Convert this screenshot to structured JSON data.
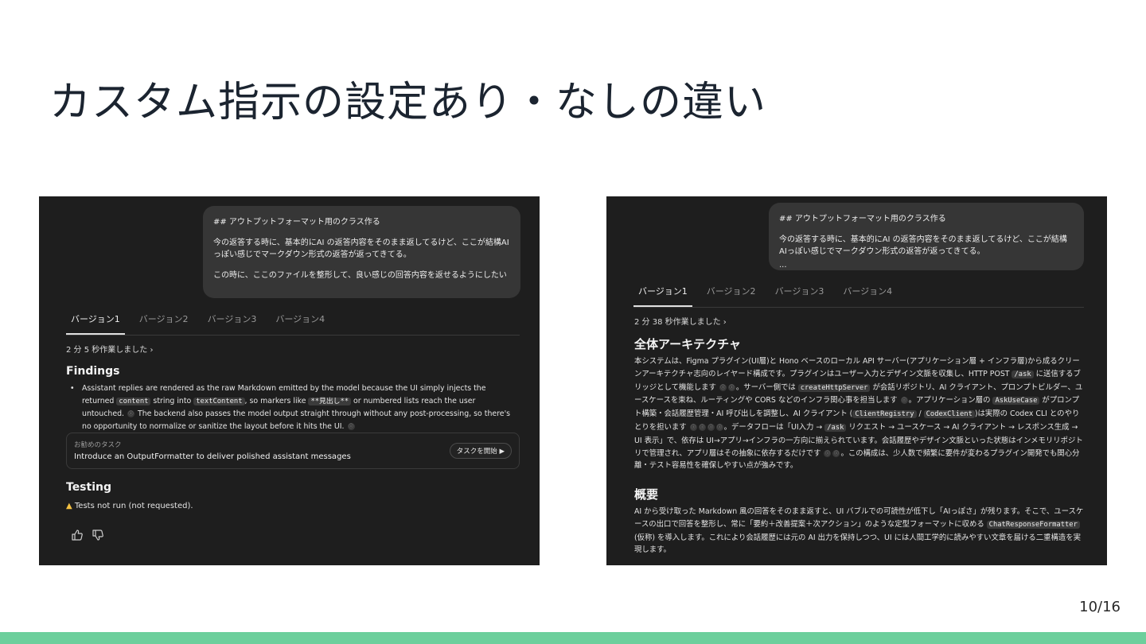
{
  "slide": {
    "title": "カスタム指示の設定あり・なしの違い",
    "page_number": "10/16",
    "accent_color": "#6ccf9c"
  },
  "left": {
    "bubble": {
      "heading": "## アウトプットフォーマット用のクラス作る",
      "para1": "今の返答する時に、基本的にAI の返答内容をそのまま返してるけど、ここが結構AIっぽい感じでマークダウン形式の返答が返ってきてる。",
      "para2": "この時に、ここのファイルを整形して、良い感じの回答内容を返せるようにしたい"
    },
    "tabs": [
      "バージョン1",
      "バージョン2",
      "バージョン3",
      "バージョン4"
    ],
    "worked": "2 分 5 秒作業しました ›",
    "findings_title": "Findings",
    "findings_bullet": {
      "t1": "Assistant replies are rendered as the raw Markdown emitted by the model because the UI simply injects the returned ",
      "c1": "content",
      "t2": " string into ",
      "c2": "textContent",
      "t3": ", so markers like ",
      "c3": "**見出し**",
      "t4": " or numbered lists reach the user untouched. ",
      "t5": " The backend also passes the model output straight through without any post-processing, so there's no opportunity to normalize or sanitize the layout before it hits the UI. "
    },
    "task": {
      "label": "お勧めのタスク",
      "title": "Introduce an OutputFormatter to deliver polished assistant messages",
      "button": "タスクを開始 ▶"
    },
    "testing_title": "Testing",
    "testing_text": "Tests not run (not requested).",
    "icons": [
      "thumbs-up-icon",
      "thumbs-down-icon"
    ]
  },
  "right": {
    "bubble": {
      "heading": "## アウトプットフォーマット用のクラス作る",
      "para1": "今の返答する時に、基本的にAI の返答内容をそのまま返してるけど、ここが結構AIっぽい感じでマークダウン形式の返答が返ってきてる。",
      "para2": "..."
    },
    "tabs": [
      "バージョン1",
      "バージョン2",
      "バージョン3",
      "バージョン4"
    ],
    "worked": "2 分 38 秒作業しました ›",
    "arch_title": "全体アーキテクチャ",
    "arch": {
      "t1": "本システムは、Figma プラグイン(UI層)と Hono ベースのローカル API サーバー(アプリケーション層 + インフラ層)から成るクリーンアーキテクチャ志向のレイヤード構成です。プラグインはユーザー入力とデザイン文脈を収集し、HTTP POST ",
      "c1": "/ask",
      "t2": " に送信するブリッジとして機能します ",
      "t3": "。サーバー側では ",
      "c2": "createHttpServer",
      "t4": " が会話リポジトリ、AI クライアント、プロンプトビルダー、ユースケースを束ね、ルーティングや CORS などのインフラ関心事を担当します ",
      "t5": "。アプリケーション層の ",
      "c3": "AskUseCase",
      "t6": " がプロンプト構築・会話履歴管理・AI 呼び出しを調整し、AI クライアント (",
      "c4": "ClientRegistry",
      "t7": " / ",
      "c5": "CodexClient",
      "t8": ")は実際の Codex CLI とのやりとりを担います ",
      "t9": "。データフローは「UI入力 → ",
      "c6": "/ask",
      "t10": " リクエスト → ユースケース → AI クライアント → レスポンス生成 → UI 表示」で、依存は UI→アプリ→インフラの一方向に揃えられています。会話履歴やデザイン文脈といった状態はインメモリリポジトリで管理され、アプリ層はその抽象に依存するだけです ",
      "t11": "。この構成は、少人数で頻繁に要件が変わるプラグイン開発でも関心分離・テスト容易性を確保しやすい点が強みです。"
    },
    "summary_title": "概要",
    "summary": {
      "t1": "AI から受け取った Markdown 風の回答をそのまま返すと、UI バブルでの可読性が低下し「AIっぽさ」が残ります。そこで、ユースケースの出口で回答を整形し、常に「要約＋改善提案＋次アクション」のような定型フォーマットに収める ",
      "c1": "ChatResponseFormatter",
      "t2": " (仮称) を導入します。これにより会話履歴には元の AI 出力を保持しつつ、UI には人間工学的に読みやすい文章を届ける二重構造を実現します。"
    },
    "cite_glyph": "ⓘ"
  }
}
